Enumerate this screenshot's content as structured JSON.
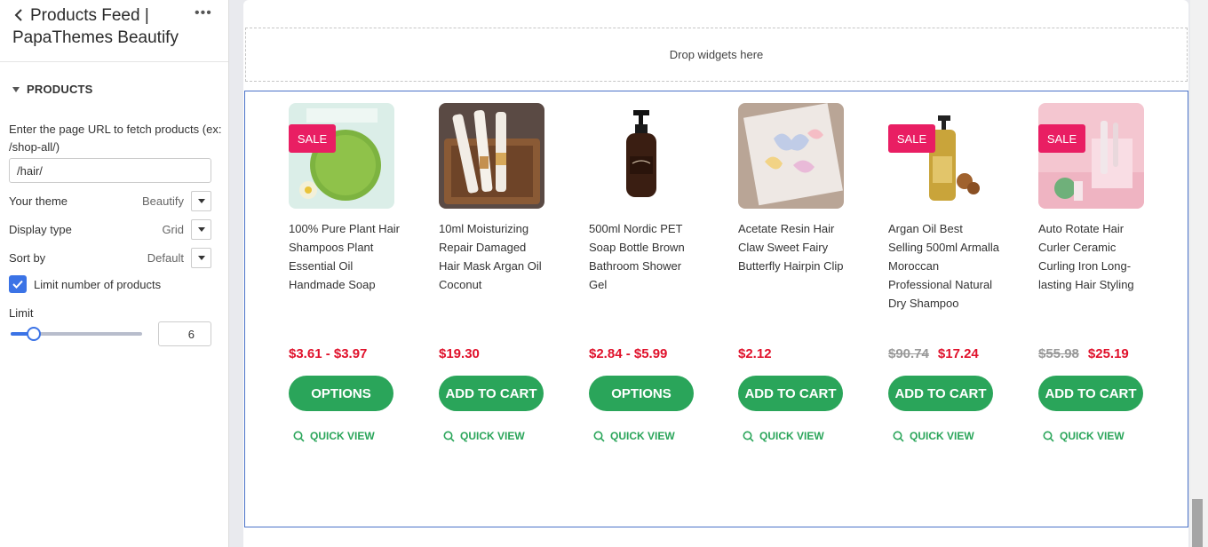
{
  "sidebar": {
    "title": "Products Feed | PapaThemes Beautify",
    "section": "PRODUCTS",
    "url_label": "Enter the page URL to fetch products (ex: /shop-all/)",
    "url_value": "/hair/",
    "theme_label": "Your theme",
    "theme_value": "Beautify",
    "display_label": "Display type",
    "display_value": "Grid",
    "sort_label": "Sort by",
    "sort_value": "Default",
    "limit_checkbox_label": "Limit number of products",
    "limit_checked": true,
    "limit_label": "Limit",
    "limit_value": "6",
    "limit_slider_fraction": 0.14
  },
  "canvas": {
    "dropzone_text": "Drop widgets here"
  },
  "colors": {
    "accent": "#3b73e6",
    "button_green": "#2aa55a",
    "sale_pink": "#e91e63",
    "price_red": "#e0112b"
  },
  "products": [
    {
      "sale": "SALE",
      "name": "100% Pure Plant Hair Shampoos Plant Essential Oil Handmade Soap",
      "price_old": "",
      "price": "$3.61 - $3.97",
      "button": "OPTIONS",
      "quick_view": "QUICK VIEW"
    },
    {
      "sale": "",
      "name": "10ml Moisturizing Repair Damaged Hair Mask Argan Oil Coconut",
      "price_old": "",
      "price": "$19.30",
      "button": "ADD TO CART",
      "quick_view": "QUICK VIEW"
    },
    {
      "sale": "",
      "name": "500ml Nordic PET Soap Bottle Brown Bathroom Shower Gel",
      "price_old": "",
      "price": "$2.84 - $5.99",
      "button": "OPTIONS",
      "quick_view": "QUICK VIEW"
    },
    {
      "sale": "",
      "name": "Acetate Resin Hair Claw Sweet Fairy Butterfly Hairpin Clip",
      "price_old": "",
      "price": "$2.12",
      "button": "ADD TO CART",
      "quick_view": "QUICK VIEW"
    },
    {
      "sale": "SALE",
      "name": "Argan Oil Best Selling 500ml Armalla Moroccan Professional Natural Dry Shampoo",
      "price_old": "$90.74",
      "price": "$17.24",
      "button": "ADD TO CART",
      "quick_view": "QUICK VIEW"
    },
    {
      "sale": "SALE",
      "name": "Auto Rotate Hair Curler Ceramic Curling Iron Long-lasting Hair Styling",
      "price_old": "$55.98",
      "price": "$25.19",
      "button": "ADD TO CART",
      "quick_view": "QUICK VIEW"
    }
  ]
}
